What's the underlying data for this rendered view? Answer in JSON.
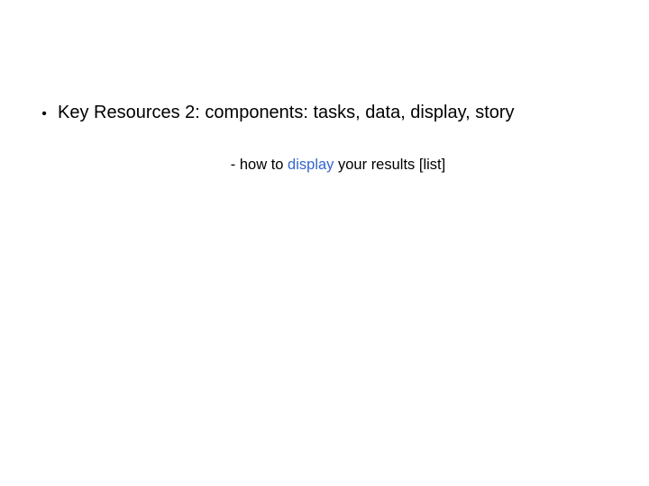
{
  "bullet": {
    "marker": "•",
    "text": "Key Resources 2: components: tasks, data, display, story"
  },
  "subline": {
    "prefix": "- how to ",
    "link": "display",
    "suffix": " your results [list]"
  }
}
